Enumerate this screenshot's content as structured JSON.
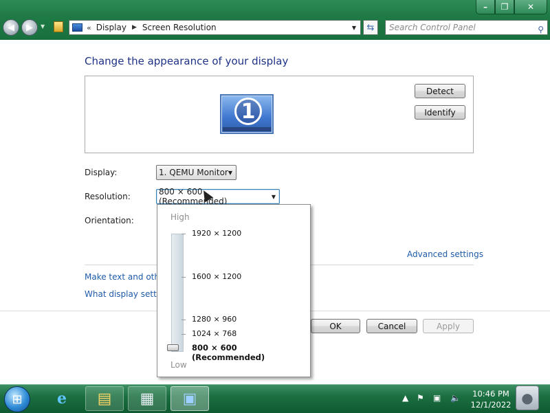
{
  "window": {
    "minimize": "–",
    "maximize": "❐",
    "close": "✕"
  },
  "navigation": {
    "back_icon": "back-arrow-icon",
    "forward_icon": "forward-arrow-icon",
    "breadcrumb_prefix": "«",
    "breadcrumb": [
      "Display",
      "Screen Resolution"
    ],
    "search_placeholder": "Search Control Panel"
  },
  "main": {
    "title": "Change the appearance of your display",
    "monitor_number": "1",
    "detect_label": "Detect",
    "identify_label": "Identify",
    "display_label": "Display:",
    "display_value": "1. QEMU Monitor",
    "resolution_label": "Resolution:",
    "resolution_value": "800 × 600 (Recommended)",
    "orientation_label": "Orientation:",
    "advanced_settings_link": "Advanced settings",
    "make_text_link": "Make text and other",
    "what_settings_link": "What display setting"
  },
  "resolution_popup": {
    "high_label": "High",
    "low_label": "Low",
    "options": [
      {
        "label": "1920 × 1200",
        "selected": false
      },
      {
        "label": "1600 × 1200",
        "selected": false
      },
      {
        "label": "1280 × 960",
        "selected": false
      },
      {
        "label": "1024 × 768",
        "selected": false
      },
      {
        "label": "800 × 600 (Recommended)",
        "selected": true
      }
    ]
  },
  "dialog_buttons": {
    "ok": "OK",
    "cancel": "Cancel",
    "apply": "Apply"
  },
  "taskbar": {
    "items": [
      "internet-explorer-icon",
      "explorer-icon",
      "calculator-icon",
      "control-panel-icon"
    ],
    "time": "10:46 PM",
    "date": "12/1/2022"
  }
}
